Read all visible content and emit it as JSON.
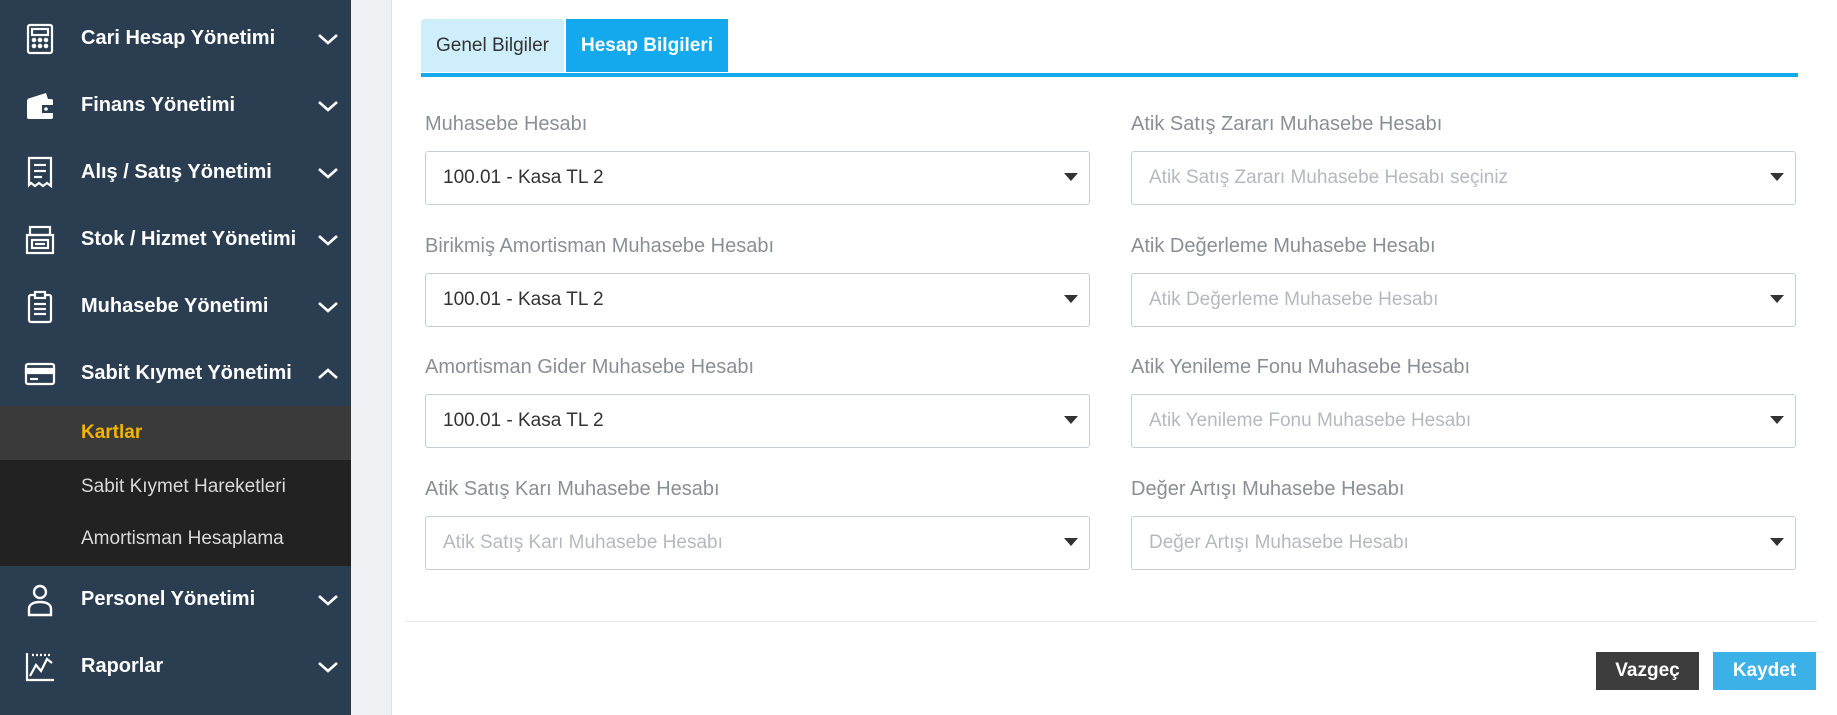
{
  "sidebar": {
    "items": [
      {
        "label": "Cari Hesap Yönetimi",
        "icon": "calculator-icon",
        "expanded": false
      },
      {
        "label": "Finans Yönetimi",
        "icon": "wallet-icon",
        "expanded": false
      },
      {
        "label": "Alış / Satış Yönetimi",
        "icon": "receipt-icon",
        "expanded": false
      },
      {
        "label": "Stok / Hizmet Yönetimi",
        "icon": "inventory-icon",
        "expanded": false
      },
      {
        "label": "Muhasebe Yönetimi",
        "icon": "clipboard-icon",
        "expanded": false
      },
      {
        "label": "Sabit Kıymet Yönetimi",
        "icon": "credit-card-icon",
        "expanded": true
      },
      {
        "label": "Personel Yönetimi",
        "icon": "user-icon",
        "expanded": false
      },
      {
        "label": "Raporlar",
        "icon": "chart-icon",
        "expanded": false
      }
    ],
    "subitems": [
      {
        "label": "Kartlar",
        "active": true
      },
      {
        "label": "Sabit Kıymet Hareketleri",
        "active": false
      },
      {
        "label": "Amortisman Hesaplama",
        "active": false
      }
    ]
  },
  "tabs": [
    {
      "label": "Genel Bilgiler",
      "active": false
    },
    {
      "label": "Hesap Bilgileri",
      "active": true
    }
  ],
  "fields": {
    "muhasebe": {
      "label": "Muhasebe Hesabı",
      "value": "100.01 - Kasa TL 2",
      "placeholder": ""
    },
    "birikmis": {
      "label": "Birikmiş Amortisman Muhasebe Hesabı",
      "value": "100.01 - Kasa TL 2",
      "placeholder": ""
    },
    "amortisman_gider": {
      "label": "Amortisman Gider Muhasebe Hesabı",
      "value": "100.01 - Kasa TL 2",
      "placeholder": ""
    },
    "atik_satis_kari": {
      "label": "Atik Satış Karı Muhasebe Hesabı",
      "value": "",
      "placeholder": "Atik Satış Karı Muhasebe Hesabı"
    },
    "atik_satis_zarari": {
      "label": "Atik Satış Zararı Muhasebe Hesabı",
      "value": "",
      "placeholder": "Atik Satış Zararı Muhasebe Hesabı seçiniz"
    },
    "atik_degerleme": {
      "label": "Atik Değerleme Muhasebe Hesabı",
      "value": "",
      "placeholder": "Atik Değerleme Muhasebe Hesabı"
    },
    "atik_yenileme": {
      "label": "Atik Yenileme Fonu Muhasebe Hesabı",
      "value": "",
      "placeholder": "Atik Yenileme Fonu Muhasebe Hesabı"
    },
    "deger_artisi": {
      "label": "Değer Artışı Muhasebe Hesabı",
      "value": "",
      "placeholder": "Değer Artışı Muhasebe Hesabı"
    }
  },
  "actions": {
    "cancel_label": "Vazgeç",
    "save_label": "Kaydet"
  },
  "colors": {
    "sidebar_bg": "#2b3e51",
    "accent": "#14a9ec",
    "active_sub": "#f5b400",
    "cancel_bg": "#3d3d3d",
    "save_bg": "#3cb1e8"
  }
}
